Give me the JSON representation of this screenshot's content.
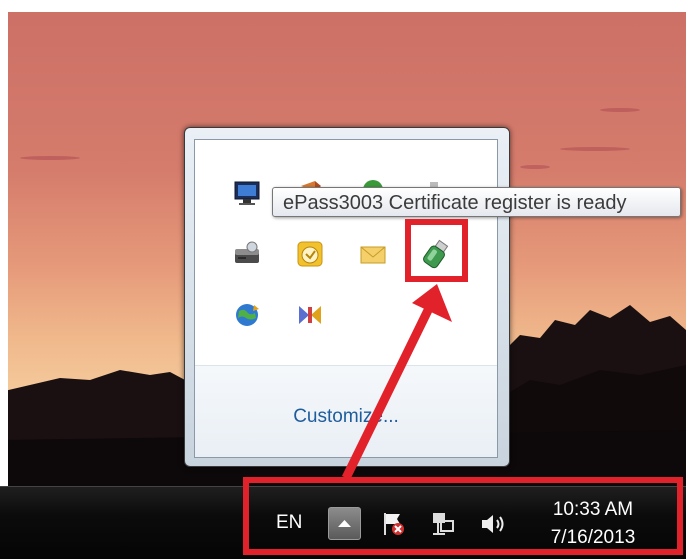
{
  "tooltip": {
    "text": "ePass3003 Certificate register is ready"
  },
  "tray_popup": {
    "customize_label": "Customize...",
    "icons": [
      "network-monitor-icon",
      "flag-arrow-icon",
      "green-circle-icon",
      "gray-device-icon",
      "disk-drive-icon",
      "outlook-clock-icon",
      "mail-envelope-icon",
      "usb-token-icon",
      "globe-refresh-icon",
      "sync-arrows-icon"
    ]
  },
  "taskbar": {
    "language": "EN",
    "time": "10:33 AM",
    "date": "7/16/2013",
    "tray_icons": [
      "action-center-flag-icon",
      "network-icon",
      "volume-icon"
    ]
  },
  "colors": {
    "highlight": "#e1222a",
    "link": "#1e5d9c",
    "taskbar": "#0b0b0b"
  }
}
